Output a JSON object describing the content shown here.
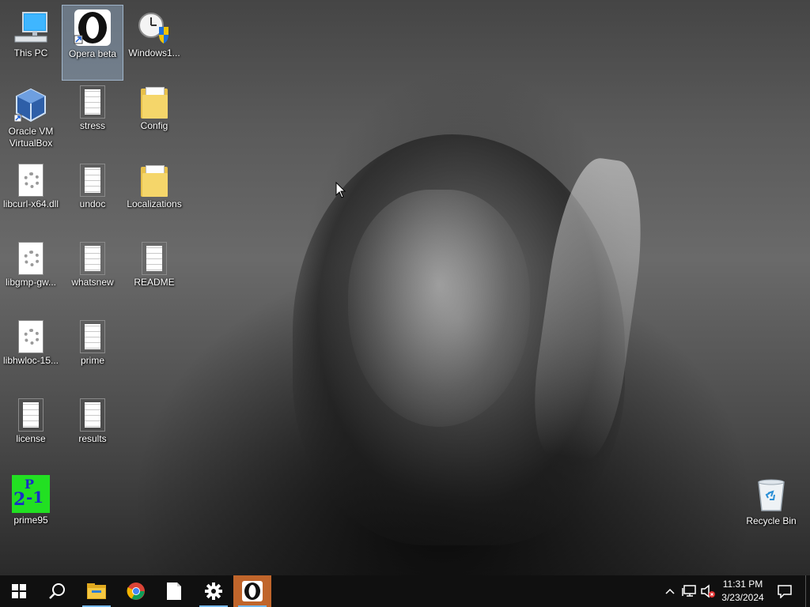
{
  "desktop": {
    "icons": [
      {
        "label": "This PC"
      },
      {
        "label": "Opera beta"
      },
      {
        "label": "Windows1..."
      },
      {
        "label": "Oracle VM VirtualBox"
      },
      {
        "label": "stress"
      },
      {
        "label": "Config"
      },
      {
        "label": "libcurl-x64.dll"
      },
      {
        "label": "undoc"
      },
      {
        "label": "Localizations"
      },
      {
        "label": "libgmp-gw..."
      },
      {
        "label": "whatsnew"
      },
      {
        "label": "README"
      },
      {
        "label": "libhwloc-15..."
      },
      {
        "label": "prime"
      },
      {
        "label": "license"
      },
      {
        "label": "results"
      },
      {
        "label": "prime95"
      },
      {
        "label": "Recycle Bin"
      }
    ],
    "prime95_logo": {
      "main": "2",
      "sup": "P",
      "tail": "-1"
    }
  },
  "taskbar": {
    "items": [
      {
        "icon": "windows-start-icon"
      },
      {
        "icon": "search-icon"
      },
      {
        "icon": "file-explorer-icon",
        "active": true
      },
      {
        "icon": "chrome-icon"
      },
      {
        "icon": "notepad-document-icon"
      },
      {
        "icon": "settings-gear-icon",
        "active": true
      },
      {
        "icon": "opera-icon",
        "active": true
      }
    ],
    "tray": {
      "time": "11:31 PM",
      "date": "3/23/2024"
    }
  },
  "colors": {
    "taskbar_bg": "#101010",
    "active_indicator": "#76b9ed",
    "opera_highlight": "#c0652b",
    "prime95_bg": "#22e022",
    "prime95_text": "#1a2cc8"
  }
}
